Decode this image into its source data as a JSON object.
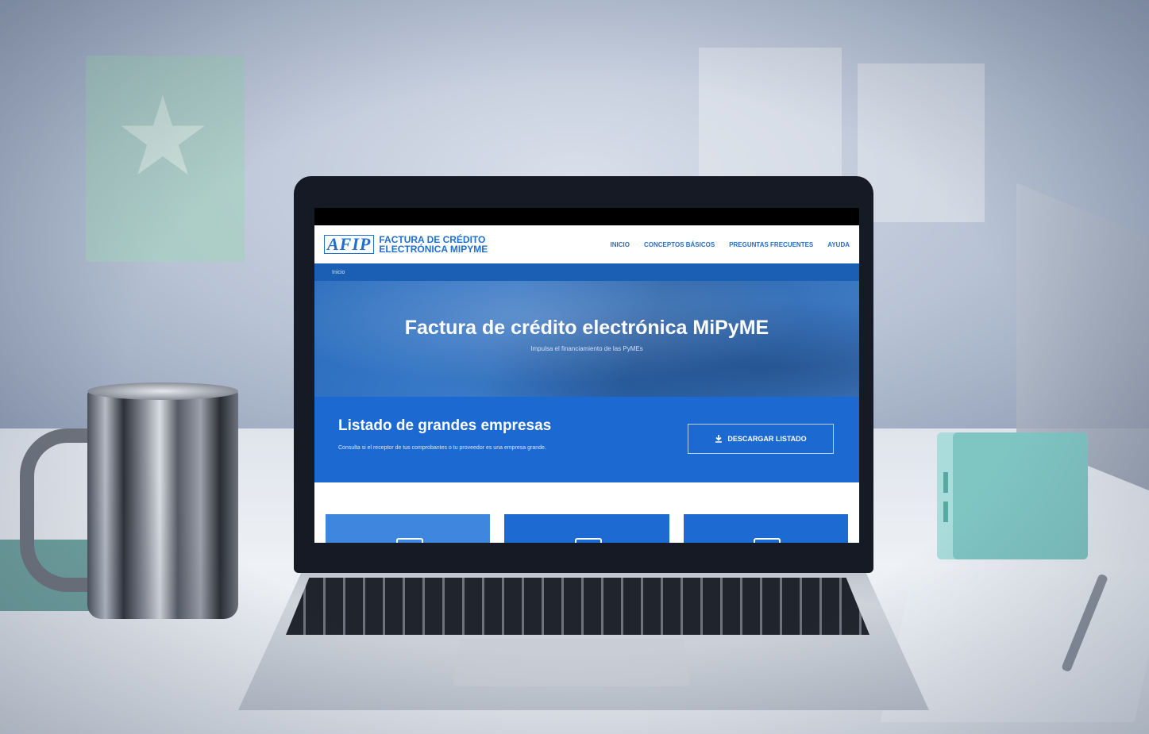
{
  "site": {
    "logo": "AFIP",
    "title_line1": "FACTURA DE CRÉDITO",
    "title_line2": "ELECTRÓNICA MIPYME",
    "nav": [
      "INICIO",
      "CONCEPTOS BÁSICOS",
      "PREGUNTAS FRECUENTES",
      "AYUDA"
    ],
    "breadcrumb": "Inicio"
  },
  "hero": {
    "title": "Factura de crédito electrónica MiPyME",
    "subtitle": "Impulsa el financiamiento de las PyMEs"
  },
  "band": {
    "title": "Listado de grandes empresas",
    "subtitle": "Consulta si el receptor de tus comprobantes o tu proveedor es una empresa grande.",
    "button_label": "DESCARGAR LISTADO",
    "button_icon": "download-icon"
  },
  "colors": {
    "brand": "#1f6fd1",
    "band": "#1c6ad1",
    "hero": "#2d6fbf"
  }
}
